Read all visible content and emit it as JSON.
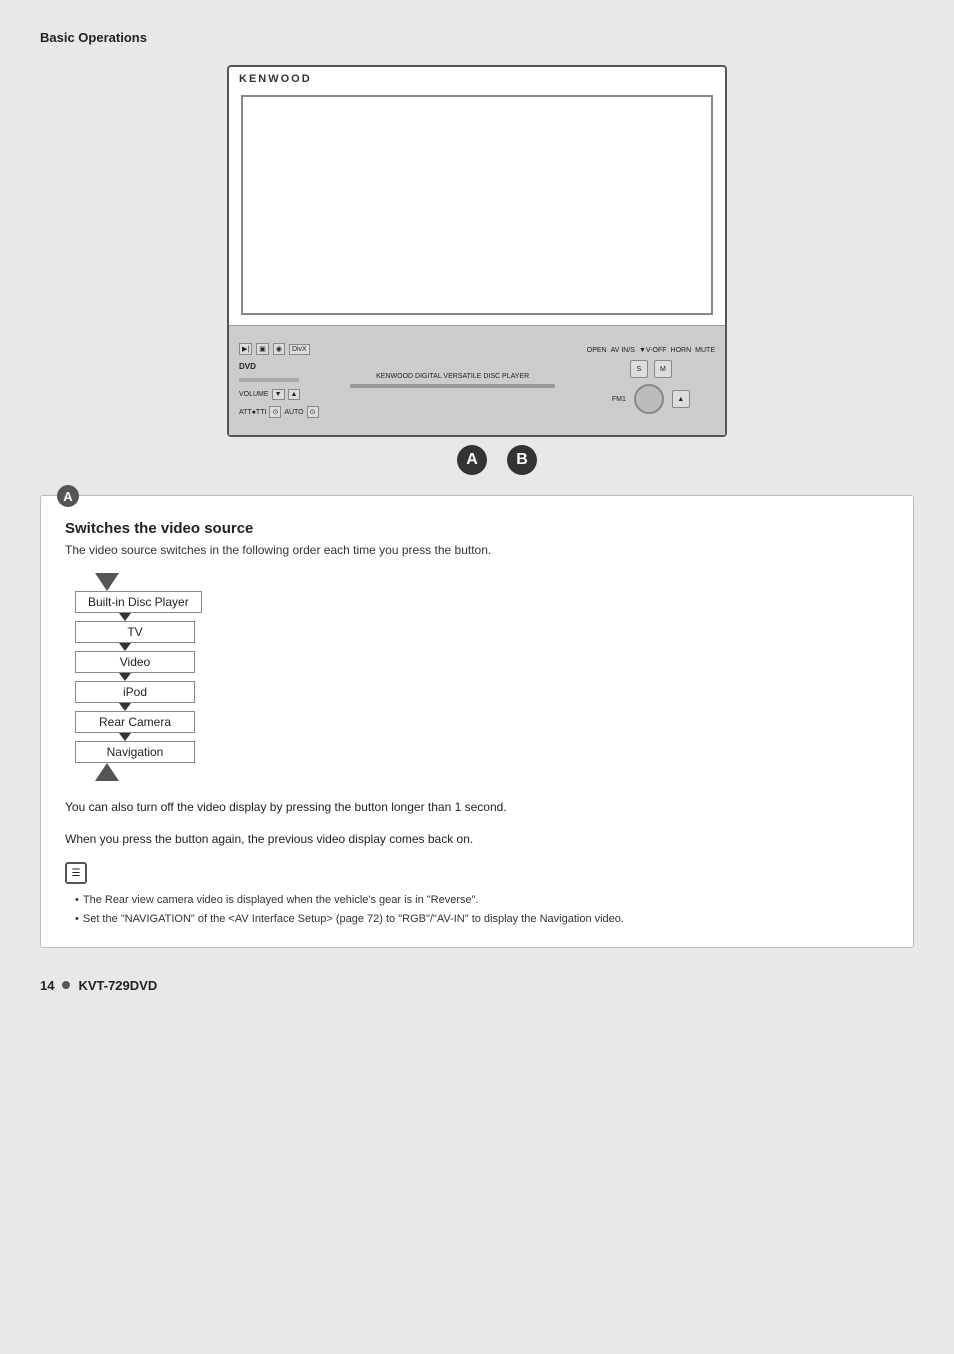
{
  "header": {
    "section_title": "Basic Operations"
  },
  "device": {
    "logo": "KENWOOD",
    "label_a": "A",
    "label_b": "B"
  },
  "section_a": {
    "badge": "A",
    "title": "Switches the video source",
    "subtitle": "The video source switches in the following order each time you press the button.",
    "flow_items": [
      "Built-in Disc Player",
      "TV",
      "Video",
      "iPod",
      "Rear Camera",
      "Navigation"
    ],
    "flow_note_line1": "You can also turn off the video display by pressing the button longer than 1 second.",
    "flow_note_line2": "When you press the button again, the previous video display comes back on.",
    "bullets": [
      "The Rear view camera video is displayed when the vehicle's gear is in \"Reverse\".",
      "Set the \"NAVIGATION\" of the <AV Interface Setup> (page 72) to \"RGB\"/\"AV-IN\" to display the Navigation video."
    ]
  },
  "footer": {
    "page_number": "14",
    "model_name": "KVT-729DVD"
  }
}
